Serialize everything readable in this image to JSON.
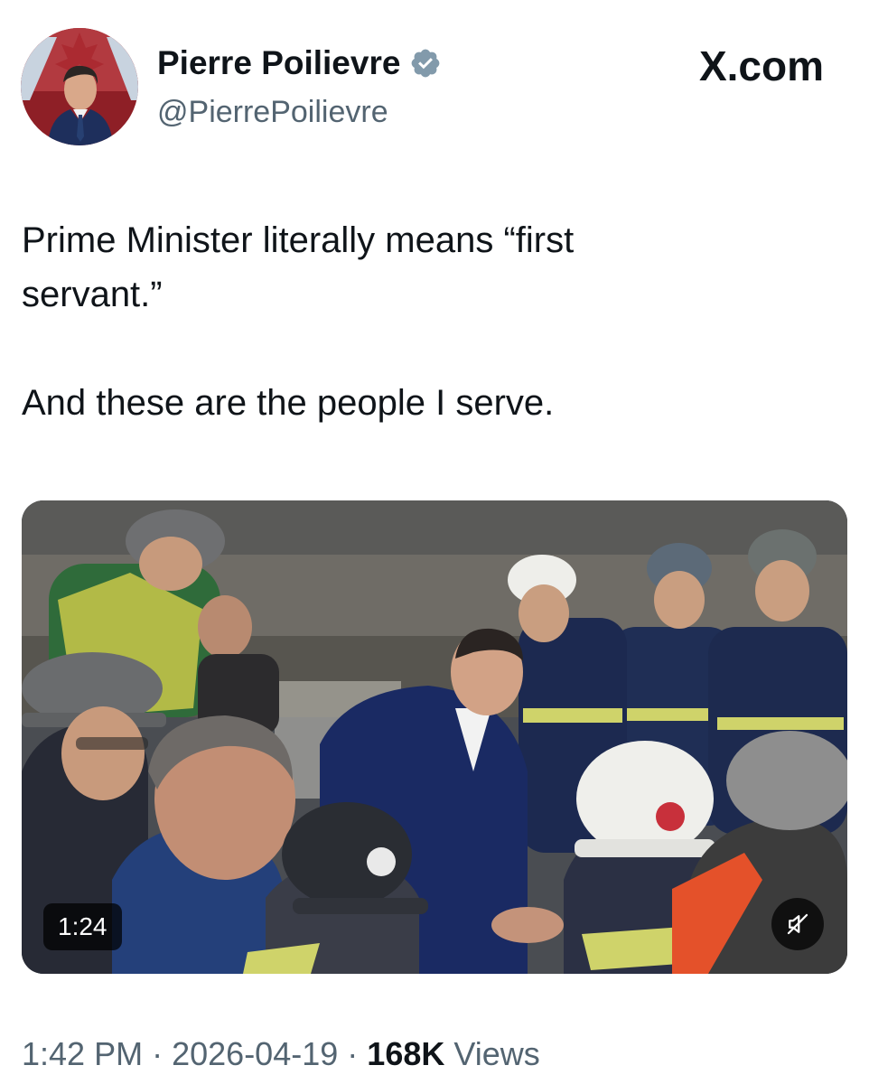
{
  "author": {
    "display_name": "Pierre Poilievre",
    "handle": "@PierrePoilievre",
    "verified": true,
    "verified_color": "#1d9bf0",
    "avatar_icon": "profile-photo-icon"
  },
  "brand": {
    "label": "X.com"
  },
  "tweet": {
    "paragraphs": [
      "Prime Minister literally means “first\nservant.”",
      "And these are the people I serve."
    ]
  },
  "media": {
    "type": "video",
    "duration": "1:24",
    "muted": true,
    "mute_icon": "speaker-muted-icon"
  },
  "meta": {
    "time": "1:42 PM",
    "separator": "·",
    "date": "2026-04-19",
    "views_count": "168K",
    "views_label": "Views"
  },
  "colors": {
    "text_primary": "#0f1419",
    "text_secondary": "#536471",
    "accent": "#1d9bf0"
  }
}
